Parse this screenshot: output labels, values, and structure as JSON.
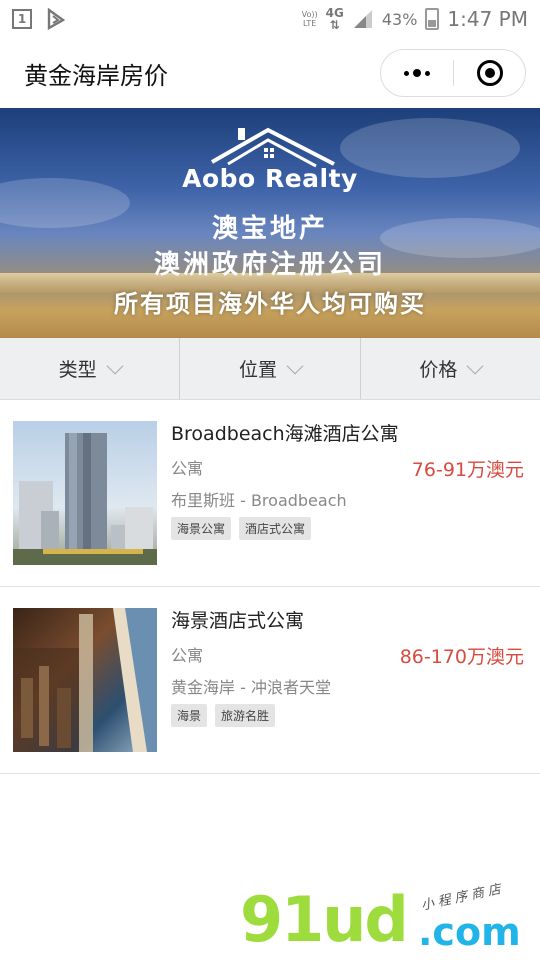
{
  "status_bar": {
    "sim_label": "1",
    "volte_top": "Vo))",
    "volte_bottom": "LTE",
    "network": "4G",
    "battery": "43%",
    "time": "1:47 PM"
  },
  "header": {
    "title": "黄金海岸房价",
    "more_icon": "more-dots-icon",
    "close_icon": "target-close-icon"
  },
  "banner": {
    "brand": "Aobo Realty",
    "line1": "澳宝地产",
    "line2": "澳洲政府注册公司",
    "line3": "所有项目海外华人均可购买"
  },
  "filters": [
    {
      "label": "类型"
    },
    {
      "label": "位置"
    },
    {
      "label": "价格"
    }
  ],
  "listings": [
    {
      "name": "Broadbeach海滩酒店公寓",
      "type": "公寓",
      "price": "76-91万澳元",
      "location": "布里斯班 - Broadbeach",
      "tags": [
        "海景公寓",
        "酒店式公寓"
      ]
    },
    {
      "name": "海景酒店式公寓",
      "type": "公寓",
      "price": "86-170万澳元",
      "location": "黄金海岸 - 冲浪者天堂",
      "tags": [
        "海景",
        "旅游名胜"
      ]
    }
  ],
  "watermark": {
    "main": "91ud",
    "domain": ".com",
    "sub": "小程序商店"
  },
  "colors": {
    "price": "#d94a3f",
    "filter_bg": "#eeeff1",
    "wm_green": "#9ddc3c",
    "wm_blue": "#21b4e9"
  }
}
